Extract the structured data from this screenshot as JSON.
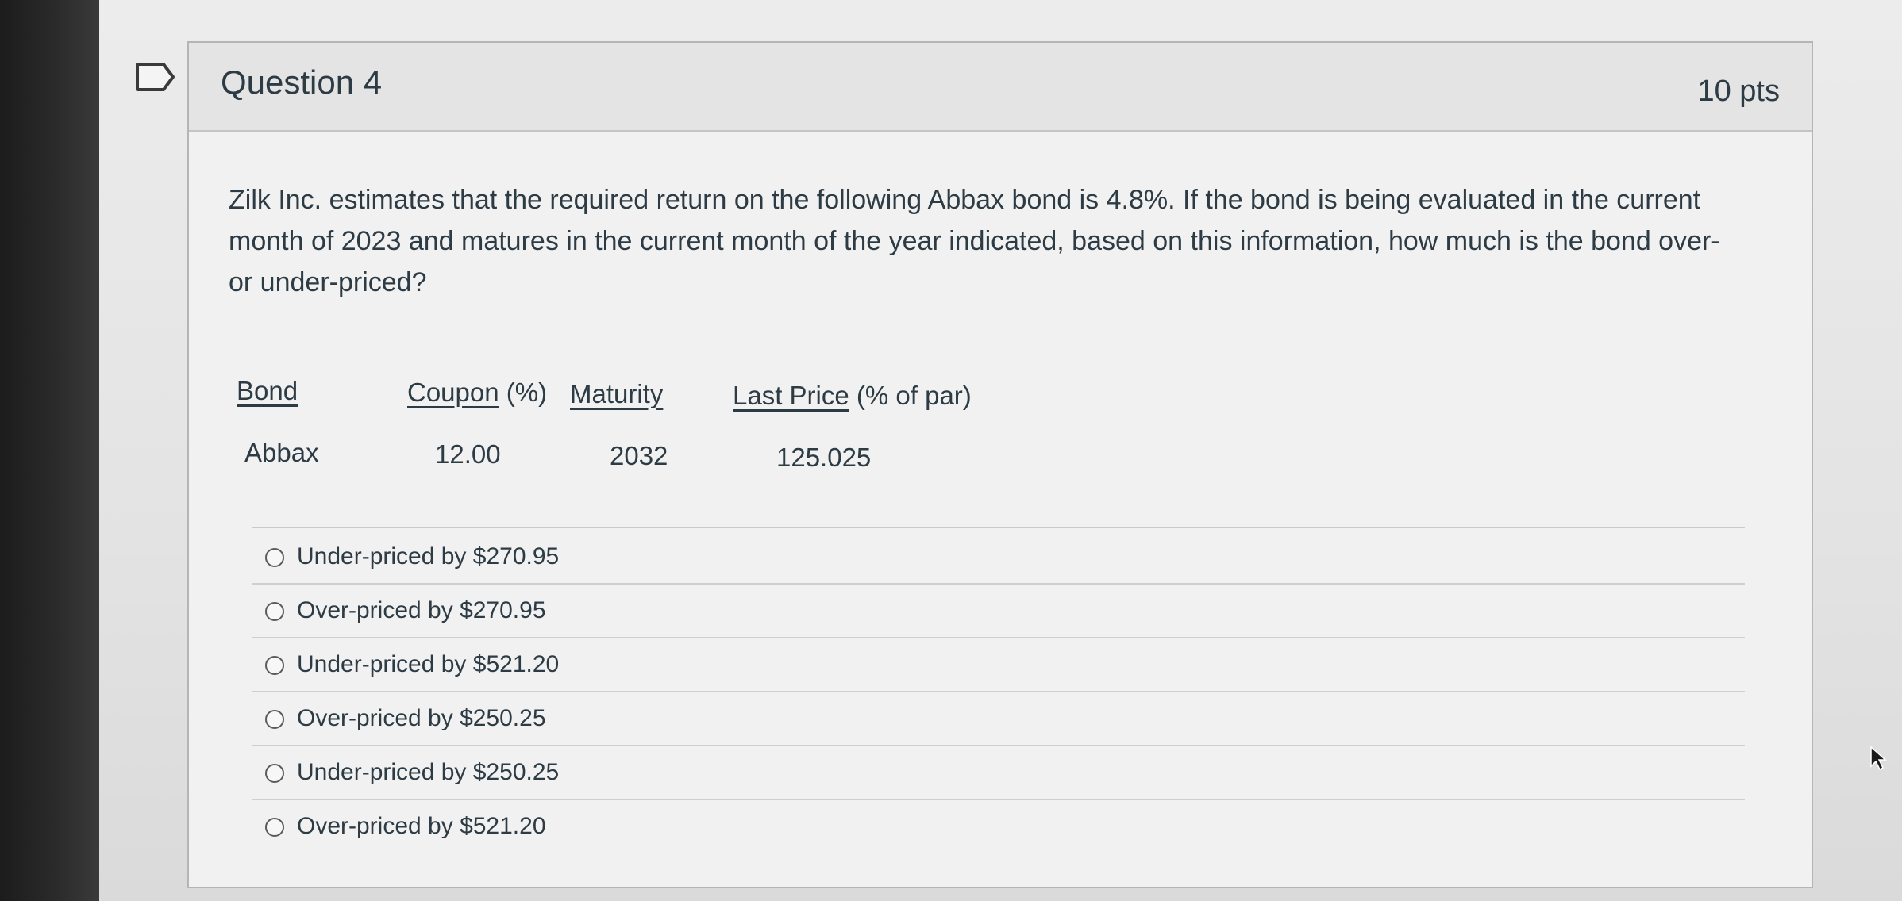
{
  "question": {
    "title": "Question 4",
    "points": "10 pts",
    "text": "Zilk Inc. estimates that the required return on the following Abbax bond is 4.8%.  If the bond is being evaluated in the current month of 2023 and matures in the current month of the year indicated, based on this information, how much is the bond over- or under-priced?"
  },
  "table": {
    "headers": {
      "bond": "Bond",
      "coupon_main": "Coupon",
      "coupon_suffix": " (%)",
      "maturity": "Maturity",
      "price_main": "Last Price",
      "price_suffix": " (% of par)"
    },
    "row": {
      "bond": "Abbax",
      "coupon": "12.00",
      "maturity": "2032",
      "price": "125.025"
    }
  },
  "answers": [
    {
      "label": "Under-priced by $270.95",
      "selected": false
    },
    {
      "label": "Over-priced by $270.95",
      "selected": false
    },
    {
      "label": "Under-priced by $521.20",
      "selected": false
    },
    {
      "label": "Over-priced by $250.25",
      "selected": false
    },
    {
      "label": "Under-priced by $250.25",
      "selected": false
    },
    {
      "label": "Over-priced by $521.20",
      "selected": false
    }
  ],
  "colors": {
    "text": "#2d3b45",
    "header_bg": "#e4e4e4",
    "card_bg": "#f1f1f1"
  },
  "icons": {
    "flag": "bookmark-flag-icon",
    "radio": "radio-button-icon",
    "cursor": "mouse-pointer-icon"
  }
}
